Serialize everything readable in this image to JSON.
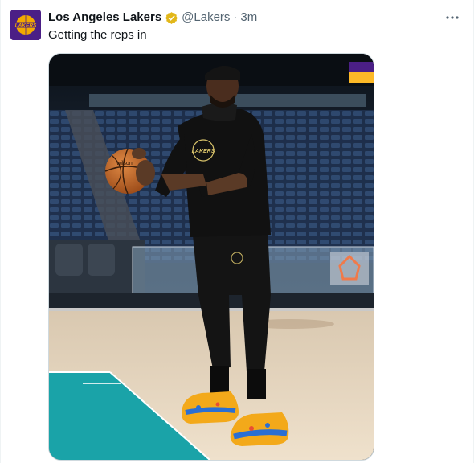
{
  "tweet": {
    "display_name": "Los Angeles Lakers",
    "handle": "@Lakers",
    "separator": "·",
    "time": "3m",
    "text": "Getting the reps in"
  },
  "avatar": {
    "icon": "lakers-logo-icon",
    "bg_color": "#4b1f86",
    "logo_text": "LAKERS"
  },
  "icons": {
    "verified": "verified-badge-icon",
    "more": "more-options-icon"
  },
  "media": {
    "alt": "Player in black hoodie and joggers holding a basketball on the court before a game",
    "shirt_text": "LAKERS"
  },
  "colors": {
    "lakers_purple": "#552583",
    "lakers_gold": "#fdb927",
    "verified_gold": "#e2b719",
    "court_teal": "#1aa3a8"
  }
}
